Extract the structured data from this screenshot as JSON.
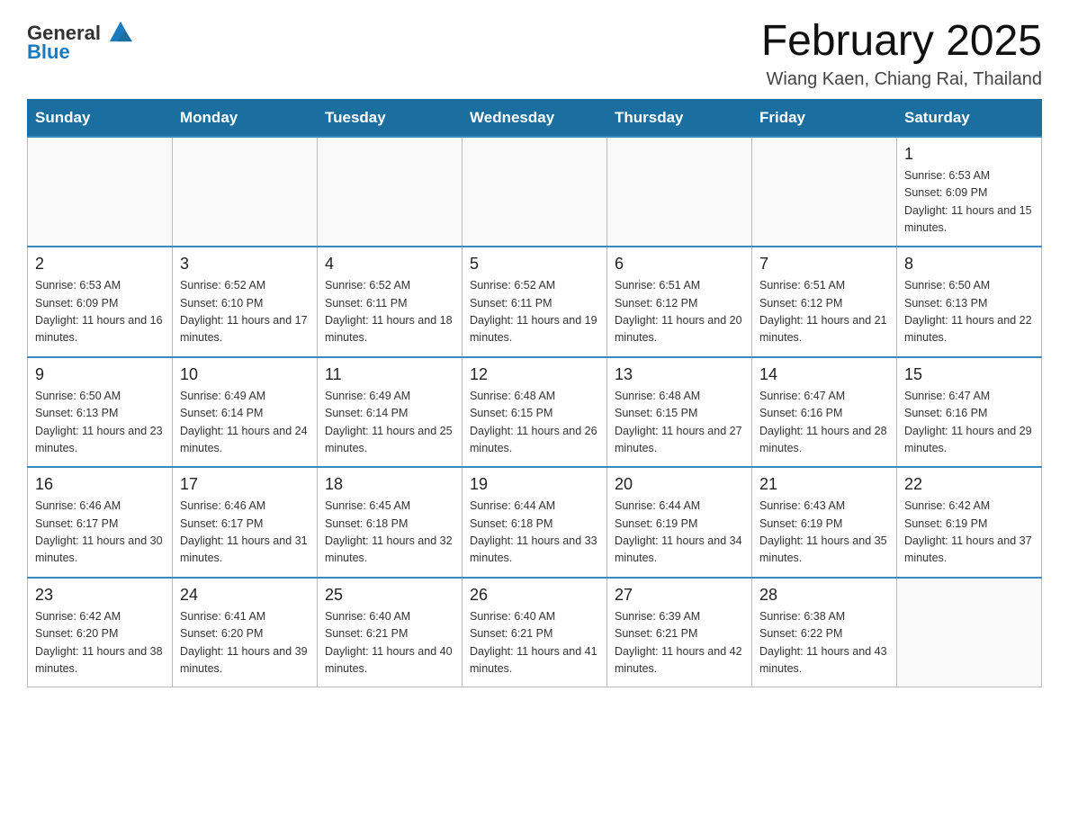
{
  "header": {
    "logo_general": "General",
    "logo_blue": "Blue",
    "month_title": "February 2025",
    "location": "Wiang Kaen, Chiang Rai, Thailand"
  },
  "days_of_week": [
    "Sunday",
    "Monday",
    "Tuesday",
    "Wednesday",
    "Thursday",
    "Friday",
    "Saturday"
  ],
  "weeks": [
    [
      {
        "day": "",
        "sunrise": "",
        "sunset": "",
        "daylight": "",
        "empty": true
      },
      {
        "day": "",
        "sunrise": "",
        "sunset": "",
        "daylight": "",
        "empty": true
      },
      {
        "day": "",
        "sunrise": "",
        "sunset": "",
        "daylight": "",
        "empty": true
      },
      {
        "day": "",
        "sunrise": "",
        "sunset": "",
        "daylight": "",
        "empty": true
      },
      {
        "day": "",
        "sunrise": "",
        "sunset": "",
        "daylight": "",
        "empty": true
      },
      {
        "day": "",
        "sunrise": "",
        "sunset": "",
        "daylight": "",
        "empty": true
      },
      {
        "day": "1",
        "sunrise": "Sunrise: 6:53 AM",
        "sunset": "Sunset: 6:09 PM",
        "daylight": "Daylight: 11 hours and 15 minutes.",
        "empty": false
      }
    ],
    [
      {
        "day": "2",
        "sunrise": "Sunrise: 6:53 AM",
        "sunset": "Sunset: 6:09 PM",
        "daylight": "Daylight: 11 hours and 16 minutes.",
        "empty": false
      },
      {
        "day": "3",
        "sunrise": "Sunrise: 6:52 AM",
        "sunset": "Sunset: 6:10 PM",
        "daylight": "Daylight: 11 hours and 17 minutes.",
        "empty": false
      },
      {
        "day": "4",
        "sunrise": "Sunrise: 6:52 AM",
        "sunset": "Sunset: 6:11 PM",
        "daylight": "Daylight: 11 hours and 18 minutes.",
        "empty": false
      },
      {
        "day": "5",
        "sunrise": "Sunrise: 6:52 AM",
        "sunset": "Sunset: 6:11 PM",
        "daylight": "Daylight: 11 hours and 19 minutes.",
        "empty": false
      },
      {
        "day": "6",
        "sunrise": "Sunrise: 6:51 AM",
        "sunset": "Sunset: 6:12 PM",
        "daylight": "Daylight: 11 hours and 20 minutes.",
        "empty": false
      },
      {
        "day": "7",
        "sunrise": "Sunrise: 6:51 AM",
        "sunset": "Sunset: 6:12 PM",
        "daylight": "Daylight: 11 hours and 21 minutes.",
        "empty": false
      },
      {
        "day": "8",
        "sunrise": "Sunrise: 6:50 AM",
        "sunset": "Sunset: 6:13 PM",
        "daylight": "Daylight: 11 hours and 22 minutes.",
        "empty": false
      }
    ],
    [
      {
        "day": "9",
        "sunrise": "Sunrise: 6:50 AM",
        "sunset": "Sunset: 6:13 PM",
        "daylight": "Daylight: 11 hours and 23 minutes.",
        "empty": false
      },
      {
        "day": "10",
        "sunrise": "Sunrise: 6:49 AM",
        "sunset": "Sunset: 6:14 PM",
        "daylight": "Daylight: 11 hours and 24 minutes.",
        "empty": false
      },
      {
        "day": "11",
        "sunrise": "Sunrise: 6:49 AM",
        "sunset": "Sunset: 6:14 PM",
        "daylight": "Daylight: 11 hours and 25 minutes.",
        "empty": false
      },
      {
        "day": "12",
        "sunrise": "Sunrise: 6:48 AM",
        "sunset": "Sunset: 6:15 PM",
        "daylight": "Daylight: 11 hours and 26 minutes.",
        "empty": false
      },
      {
        "day": "13",
        "sunrise": "Sunrise: 6:48 AM",
        "sunset": "Sunset: 6:15 PM",
        "daylight": "Daylight: 11 hours and 27 minutes.",
        "empty": false
      },
      {
        "day": "14",
        "sunrise": "Sunrise: 6:47 AM",
        "sunset": "Sunset: 6:16 PM",
        "daylight": "Daylight: 11 hours and 28 minutes.",
        "empty": false
      },
      {
        "day": "15",
        "sunrise": "Sunrise: 6:47 AM",
        "sunset": "Sunset: 6:16 PM",
        "daylight": "Daylight: 11 hours and 29 minutes.",
        "empty": false
      }
    ],
    [
      {
        "day": "16",
        "sunrise": "Sunrise: 6:46 AM",
        "sunset": "Sunset: 6:17 PM",
        "daylight": "Daylight: 11 hours and 30 minutes.",
        "empty": false
      },
      {
        "day": "17",
        "sunrise": "Sunrise: 6:46 AM",
        "sunset": "Sunset: 6:17 PM",
        "daylight": "Daylight: 11 hours and 31 minutes.",
        "empty": false
      },
      {
        "day": "18",
        "sunrise": "Sunrise: 6:45 AM",
        "sunset": "Sunset: 6:18 PM",
        "daylight": "Daylight: 11 hours and 32 minutes.",
        "empty": false
      },
      {
        "day": "19",
        "sunrise": "Sunrise: 6:44 AM",
        "sunset": "Sunset: 6:18 PM",
        "daylight": "Daylight: 11 hours and 33 minutes.",
        "empty": false
      },
      {
        "day": "20",
        "sunrise": "Sunrise: 6:44 AM",
        "sunset": "Sunset: 6:19 PM",
        "daylight": "Daylight: 11 hours and 34 minutes.",
        "empty": false
      },
      {
        "day": "21",
        "sunrise": "Sunrise: 6:43 AM",
        "sunset": "Sunset: 6:19 PM",
        "daylight": "Daylight: 11 hours and 35 minutes.",
        "empty": false
      },
      {
        "day": "22",
        "sunrise": "Sunrise: 6:42 AM",
        "sunset": "Sunset: 6:19 PM",
        "daylight": "Daylight: 11 hours and 37 minutes.",
        "empty": false
      }
    ],
    [
      {
        "day": "23",
        "sunrise": "Sunrise: 6:42 AM",
        "sunset": "Sunset: 6:20 PM",
        "daylight": "Daylight: 11 hours and 38 minutes.",
        "empty": false
      },
      {
        "day": "24",
        "sunrise": "Sunrise: 6:41 AM",
        "sunset": "Sunset: 6:20 PM",
        "daylight": "Daylight: 11 hours and 39 minutes.",
        "empty": false
      },
      {
        "day": "25",
        "sunrise": "Sunrise: 6:40 AM",
        "sunset": "Sunset: 6:21 PM",
        "daylight": "Daylight: 11 hours and 40 minutes.",
        "empty": false
      },
      {
        "day": "26",
        "sunrise": "Sunrise: 6:40 AM",
        "sunset": "Sunset: 6:21 PM",
        "daylight": "Daylight: 11 hours and 41 minutes.",
        "empty": false
      },
      {
        "day": "27",
        "sunrise": "Sunrise: 6:39 AM",
        "sunset": "Sunset: 6:21 PM",
        "daylight": "Daylight: 11 hours and 42 minutes.",
        "empty": false
      },
      {
        "day": "28",
        "sunrise": "Sunrise: 6:38 AM",
        "sunset": "Sunset: 6:22 PM",
        "daylight": "Daylight: 11 hours and 43 minutes.",
        "empty": false
      },
      {
        "day": "",
        "sunrise": "",
        "sunset": "",
        "daylight": "",
        "empty": true
      }
    ]
  ]
}
